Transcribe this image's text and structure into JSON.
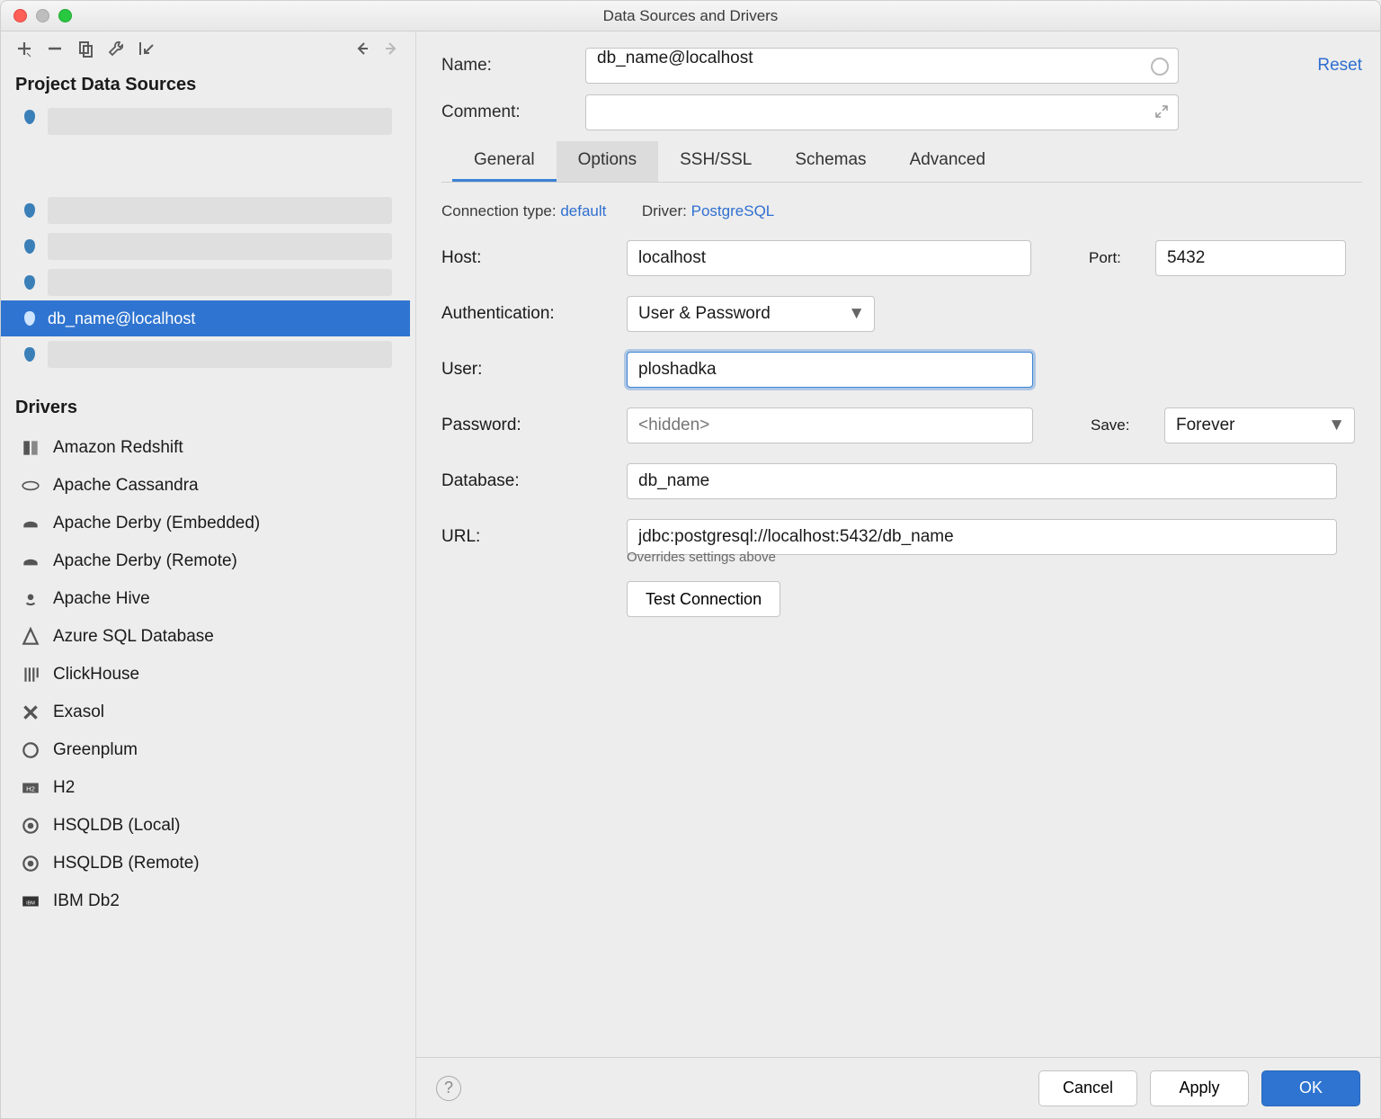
{
  "title": "Data Sources and Drivers",
  "toolbar": {
    "project_header": "Project Data Sources",
    "drivers_header": "Drivers"
  },
  "datasources": {
    "selected_label": "db_name@localhost"
  },
  "drivers": {
    "items": [
      {
        "label": "Amazon Redshift",
        "icon": "redshift"
      },
      {
        "label": "Apache Cassandra",
        "icon": "cassandra"
      },
      {
        "label": "Apache Derby (Embedded)",
        "icon": "derby"
      },
      {
        "label": "Apache Derby (Remote)",
        "icon": "derby"
      },
      {
        "label": "Apache Hive",
        "icon": "hive"
      },
      {
        "label": "Azure SQL Database",
        "icon": "azure"
      },
      {
        "label": "ClickHouse",
        "icon": "clickhouse"
      },
      {
        "label": "Exasol",
        "icon": "exasol"
      },
      {
        "label": "Greenplum",
        "icon": "greenplum"
      },
      {
        "label": "H2",
        "icon": "h2"
      },
      {
        "label": "HSQLDB (Local)",
        "icon": "hsqldb"
      },
      {
        "label": "HSQLDB (Remote)",
        "icon": "hsqldb"
      },
      {
        "label": "IBM Db2",
        "icon": "db2"
      }
    ]
  },
  "form": {
    "name_label": "Name:",
    "name_value": "db_name@localhost",
    "comment_label": "Comment:",
    "reset": "Reset",
    "tabs": [
      "General",
      "Options",
      "SSH/SSL",
      "Schemas",
      "Advanced"
    ],
    "conn_type_label": "Connection type:",
    "conn_type_value": "default",
    "driver_label": "Driver:",
    "driver_value": "PostgreSQL",
    "host_label": "Host:",
    "host_value": "localhost",
    "port_label": "Port:",
    "port_value": "5432",
    "auth_label": "Authentication:",
    "auth_value": "User & Password",
    "user_label": "User:",
    "user_value": "ploshadka",
    "password_label": "Password:",
    "password_placeholder": "<hidden>",
    "save_label": "Save:",
    "save_value": "Forever",
    "database_label": "Database:",
    "database_value": "db_name",
    "url_label": "URL:",
    "url_value": "jdbc:postgresql://localhost:5432/db_name",
    "url_hint": "Overrides settings above",
    "test_btn": "Test Connection"
  },
  "footer": {
    "cancel": "Cancel",
    "apply": "Apply",
    "ok": "OK"
  }
}
